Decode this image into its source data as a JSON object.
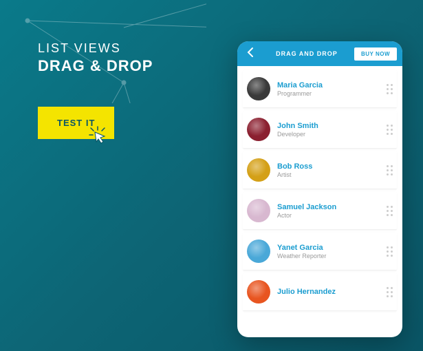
{
  "promo": {
    "line1": "LIST VIEWS",
    "line2": "DRAG & DROP",
    "test_label": "TEST IT"
  },
  "appbar": {
    "title": "DRAG AND DROP",
    "buy_label": "BUY NOW"
  },
  "colors": {
    "accent": "#1b9dd0",
    "cta": "#f4e400"
  },
  "people": [
    {
      "name": "Maria Garcia",
      "role": "Programmer",
      "avatar": "#3a3a3a"
    },
    {
      "name": "John Smith",
      "role": "Developer",
      "avatar": "#8b2030"
    },
    {
      "name": "Bob Ross",
      "role": "Artist",
      "avatar": "#d4a017"
    },
    {
      "name": "Samuel Jackson",
      "role": "Actor",
      "avatar": "#d8b8d0"
    },
    {
      "name": "Yanet Garcia",
      "role": "Weather Reporter",
      "avatar": "#4aa8d8"
    },
    {
      "name": "Julio Hernandez",
      "role": "",
      "avatar": "#e85520"
    }
  ]
}
